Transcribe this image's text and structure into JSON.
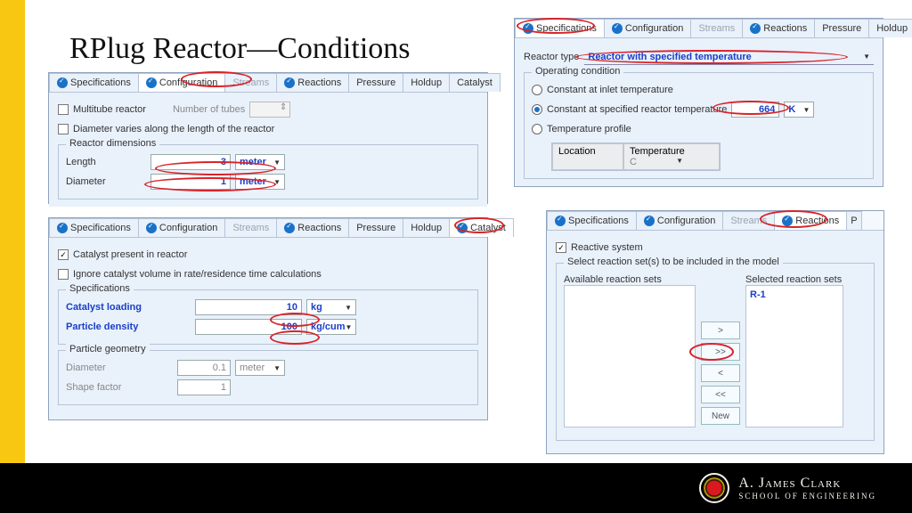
{
  "title": "RPlug Reactor—Conditions",
  "tabs_common": {
    "specifications": "Specifications",
    "configuration": "Configuration",
    "streams": "Streams",
    "reactions": "Reactions",
    "pressure": "Pressure",
    "holdup": "Holdup",
    "catalyst": "Catalyst"
  },
  "config_panel": {
    "multitube": "Multitube reactor",
    "ntubes": "Number of tubes",
    "diam_varies": "Diameter varies along the length of the reactor",
    "dimensions_group": "Reactor dimensions",
    "length_label": "Length",
    "length_value": "3",
    "length_unit": "meter",
    "diameter_label": "Diameter",
    "diameter_value": "1",
    "diameter_unit": "meter"
  },
  "catalyst_panel": {
    "present": "Catalyst present in reactor",
    "ignore": "Ignore catalyst volume in rate/residence time calculations",
    "specs_group": "Specifications",
    "loading_label": "Catalyst loading",
    "loading_value": "10",
    "loading_unit": "kg",
    "density_label": "Particle density",
    "density_value": "100",
    "density_unit": "kg/cum",
    "geom_group": "Particle geometry",
    "pg_diam_label": "Diameter",
    "pg_diam_value": "0.1",
    "pg_diam_unit": "meter",
    "shape_label": "Shape factor",
    "shape_value": "1"
  },
  "spec_panel": {
    "reactor_type_label": "Reactor type",
    "reactor_type_value": "Reactor with specified temperature",
    "opcond_group": "Operating condition",
    "opt_inlet": "Constant at inlet temperature",
    "opt_spec": "Constant at specified reactor temperature",
    "opt_profile": "Temperature profile",
    "temp_value": "664",
    "temp_unit": "K",
    "col_location": "Location",
    "col_temperature": "Temperature",
    "unit_tbl": "C"
  },
  "react_panel": {
    "reactive": "Reactive system",
    "select_group": "Select reaction set(s) to be included in the model",
    "available": "Available reaction sets",
    "selected": "Selected reaction sets",
    "selected_item": "R-1",
    "btn_gt": ">",
    "btn_gtgt": ">>",
    "btn_lt": "<",
    "btn_ltlt": "<<",
    "btn_new": "New"
  },
  "footer": {
    "line1": "A. James Clark",
    "line2": "SCHOOL OF ENGINEERING"
  }
}
